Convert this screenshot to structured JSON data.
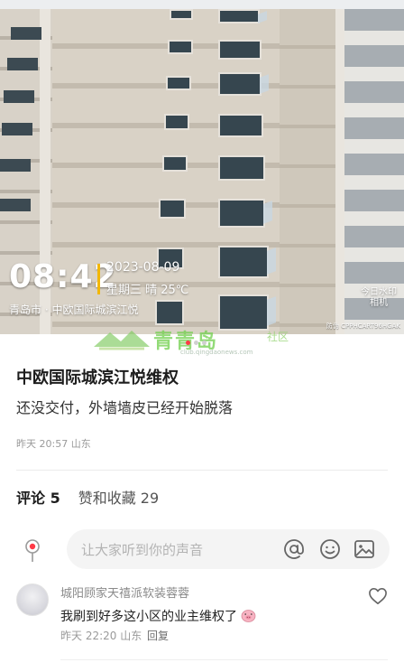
{
  "photo": {
    "time": "08:42",
    "date": "2023-08-09",
    "weekday_weather": "星期三 晴 25℃",
    "place": "青岛市 · 中欧国际城滨江悦",
    "brand_top": "今日水印",
    "brand_bottom": "相机",
    "security_code": "防伪 CPPHCART96HGAK"
  },
  "site_watermark": {
    "name": "青青岛",
    "tag": "社区",
    "url": "club.qingdaonews.com"
  },
  "carousel": {
    "count": 3,
    "active_index": 0
  },
  "post": {
    "title": "中欧国际城滨江悦维权",
    "body": "还没交付，外墙墙皮已经开始脱落",
    "meta": "昨天 20:57 山东"
  },
  "tabs": [
    {
      "label": "评论 5"
    },
    {
      "label": "赞和收藏 29"
    }
  ],
  "comment_input": {
    "placeholder": "让大家听到你的声音"
  },
  "comment": {
    "user": "城阳顾家天禧派软装蓉蓉",
    "text": "我刷到好多这小区的业主维权了",
    "time_location": "昨天 22:20 山东",
    "reply_label": "回复"
  },
  "colors": {
    "accent": "#ff3a46",
    "timestamp_bar": "#f2b705",
    "site_green": "#6fcf4b"
  }
}
